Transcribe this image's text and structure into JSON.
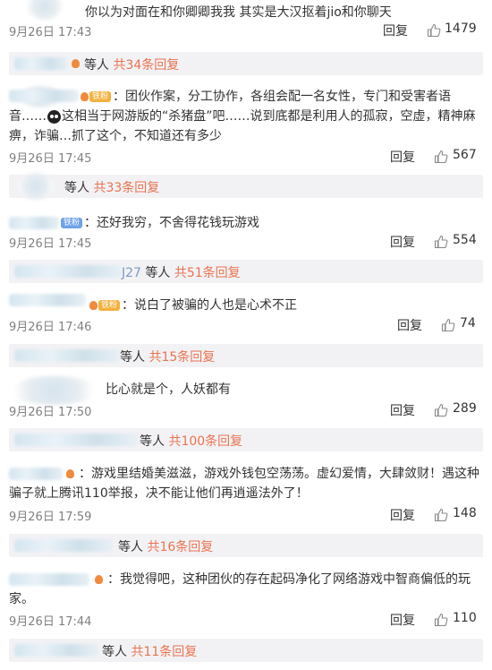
{
  "comments": [
    {
      "text": "你以为对面在和你卿卿我我 其实是大汉抠着jio和你聊天",
      "date": "9月26日 17:43",
      "reply": "回复",
      "likes": "1479",
      "sub_replies": {
        "prefix": "",
        "count_text": "等人",
        "link": "共34条回复"
      }
    },
    {
      "badge": "铁粉",
      "text_before_emoji": "：团伙作案，分工协作，各组会配一名女性，专门和受害者语音……",
      "emoji": "doge",
      "text_after_emoji": "这相当于网游版的“杀猪盘”吧……说到底都是利用人的孤寂，空虚，精神麻痹，诈骗…抓了这个，不知道还有多少",
      "date": "9月26日 17:45",
      "reply": "回复",
      "likes": "567",
      "sub_replies": {
        "prefix": "",
        "count_text": "等人",
        "link": "共33条回复"
      }
    },
    {
      "badge": "铁粉",
      "text": "：还好我穷，不舍得花钱玩游戏",
      "date": "9月26日 17:45",
      "reply": "回复",
      "likes": "554",
      "sub_replies": {
        "prefix": "J27",
        "count_text": "等人",
        "link": "共51条回复"
      }
    },
    {
      "badge": "铁粉",
      "text": "：说白了被骗的人也是心术不正",
      "date": "9月26日 17:46",
      "reply": "回复",
      "likes": "74",
      "sub_replies": {
        "prefix": "",
        "count_text": "等人",
        "link": "共15条回复"
      }
    },
    {
      "text": "比心就是个，人妖都有",
      "date": "9月26日 17:50",
      "reply": "回复",
      "likes": "289",
      "sub_replies": {
        "prefix": "",
        "count_text": "等人",
        "link": "共100条回复"
      }
    },
    {
      "text": "：游戏里结婚美滋滋，游戏外钱包空荡荡。虚幻爱情，大肆敛财！遇这种骗子就上腾讯110举报，决不能让他们再逍遥法外了！",
      "date": "9月26日 17:59",
      "reply": "回复",
      "likes": "148",
      "sub_replies": {
        "prefix": "",
        "count_text": "等人",
        "link": "共16条回复"
      }
    },
    {
      "text": "：我觉得吧，这种团伙的存在起码净化了网络游戏中智商偏低的玩家。",
      "date": "9月26日 17:44",
      "reply": "回复",
      "likes": "110",
      "sub_replies": {
        "prefix": "",
        "count_text": "等人",
        "link": "共11条回复"
      }
    }
  ],
  "colors": {
    "link": "#eb7350",
    "date": "#808080",
    "subbar_bg": "#f2f2f5"
  },
  "icons": {
    "like": "thumbs-up-icon",
    "emoji": "doge-emoji-icon",
    "medal": "fan-medal-icon"
  }
}
